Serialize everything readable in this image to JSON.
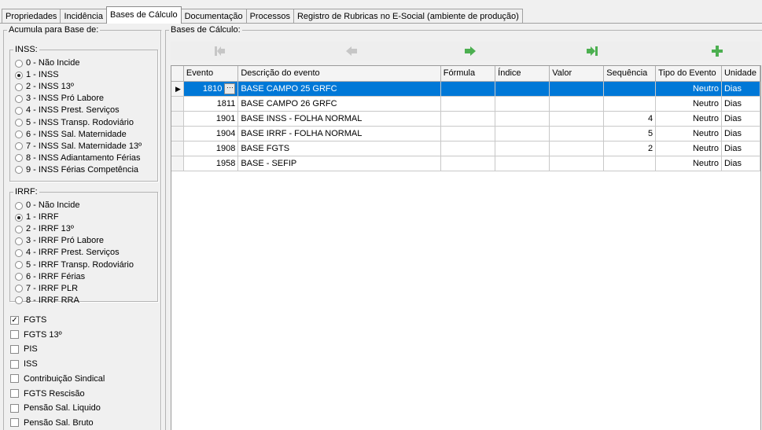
{
  "tabs": [
    {
      "label": "Propriedades"
    },
    {
      "label": "Incidência"
    },
    {
      "label": "Bases de Cálculo",
      "active": true
    },
    {
      "label": "Documentação"
    },
    {
      "label": "Processos"
    },
    {
      "label": "Registro de Rubricas no E-Social (ambiente de produção)"
    }
  ],
  "left": {
    "legend": "Acumula para Base de:",
    "inss": {
      "legend": "INSS:",
      "options": [
        {
          "label": "0 - Não Incide",
          "selected": false
        },
        {
          "label": "1 - INSS",
          "selected": true
        },
        {
          "label": "2 - INSS 13º",
          "selected": false
        },
        {
          "label": "3 - INSS Pró Labore",
          "selected": false
        },
        {
          "label": "4 - INSS Prest. Serviços",
          "selected": false
        },
        {
          "label": "5 - INSS Transp. Rodoviário",
          "selected": false
        },
        {
          "label": "6 - INSS Sal. Maternidade",
          "selected": false
        },
        {
          "label": "7 - INSS Sal. Maternidade 13º",
          "selected": false
        },
        {
          "label": "8 - INSS Adiantamento Férias",
          "selected": false
        },
        {
          "label": "9 - INSS Férias Competência",
          "selected": false
        }
      ]
    },
    "irrf": {
      "legend": "IRRF:",
      "options": [
        {
          "label": "0 - Não Incide",
          "selected": false
        },
        {
          "label": "1 - IRRF",
          "selected": true
        },
        {
          "label": "2 - IRRF 13º",
          "selected": false
        },
        {
          "label": "3 - IRRF Pró Labore",
          "selected": false
        },
        {
          "label": "4 - IRRF Prest. Serviços",
          "selected": false
        },
        {
          "label": "5 - IRRF Transp. Rodoviário",
          "selected": false
        },
        {
          "label": "6 - IRRF Férias",
          "selected": false
        },
        {
          "label": "7 - IRRF PLR",
          "selected": false
        },
        {
          "label": "8 - IRRF RRA",
          "selected": false
        }
      ]
    },
    "checks": [
      {
        "label": "FGTS",
        "checked": true
      },
      {
        "label": "FGTS 13º",
        "checked": false
      },
      {
        "label": "PIS",
        "checked": false
      },
      {
        "label": "ISS",
        "checked": false
      },
      {
        "label": "Contribuição Sindical",
        "checked": false
      },
      {
        "label": "FGTS Rescisão",
        "checked": false
      },
      {
        "label": "Pensão Sal. Liquido",
        "checked": false
      },
      {
        "label": "Pensão Sal. Bruto",
        "checked": false
      }
    ]
  },
  "right": {
    "legend": "Bases de Cálculo:",
    "nav": [
      {
        "name": "first-record-icon",
        "enabled": false
      },
      {
        "name": "prior-record-icon",
        "enabled": false
      },
      {
        "name": "next-record-icon",
        "enabled": true
      },
      {
        "name": "last-record-icon",
        "enabled": true
      },
      {
        "name": "add-record-icon",
        "enabled": true
      }
    ],
    "colors": {
      "enabled": "#4caf50",
      "disabled": "#c6c6c6",
      "selection": "#0078d7"
    },
    "columns": [
      "Evento",
      "Descrição do evento",
      "Fórmula",
      "Índice",
      "Valor",
      "Sequência",
      "Tipo do Evento",
      "Unidade"
    ],
    "rows": [
      {
        "evento": "1810",
        "descricao": "BASE CAMPO 25 GRFC",
        "formula": "",
        "indice": "",
        "valor": "",
        "sequencia": "",
        "tipo": "Neutro",
        "unidade": "Dias",
        "selected": true
      },
      {
        "evento": "1811",
        "descricao": "BASE CAMPO 26 GRFC",
        "formula": "",
        "indice": "",
        "valor": "",
        "sequencia": "",
        "tipo": "Neutro",
        "unidade": "Dias"
      },
      {
        "evento": "1901",
        "descricao": "BASE INSS - FOLHA NORMAL",
        "formula": "",
        "indice": "",
        "valor": "",
        "sequencia": "4",
        "tipo": "Neutro",
        "unidade": "Dias"
      },
      {
        "evento": "1904",
        "descricao": "BASE IRRF - FOLHA NORMAL",
        "formula": "",
        "indice": "",
        "valor": "",
        "sequencia": "5",
        "tipo": "Neutro",
        "unidade": "Dias"
      },
      {
        "evento": "1908",
        "descricao": "BASE FGTS",
        "formula": "",
        "indice": "",
        "valor": "",
        "sequencia": "2",
        "tipo": "Neutro",
        "unidade": "Dias"
      },
      {
        "evento": "1958",
        "descricao": "BASE - SEFIP",
        "formula": "",
        "indice": "",
        "valor": "",
        "sequencia": "",
        "tipo": "Neutro",
        "unidade": "Dias"
      }
    ]
  }
}
